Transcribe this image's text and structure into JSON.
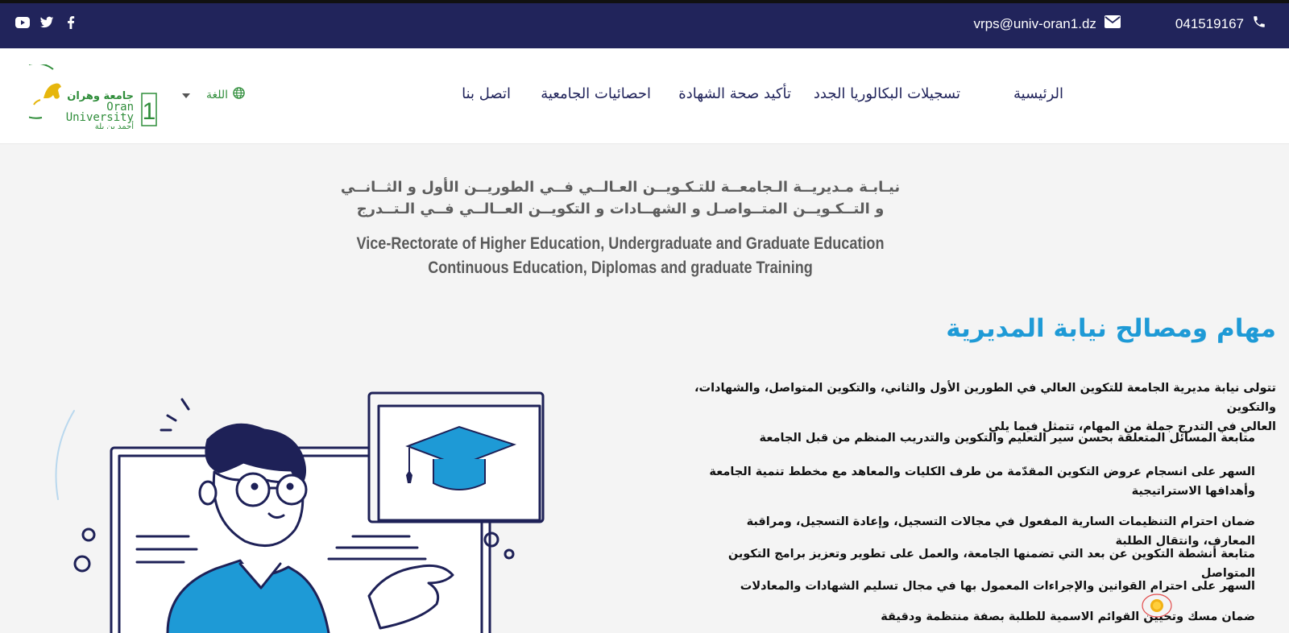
{
  "topbar": {
    "email": "vrps@univ-oran1.dz",
    "phone": "041519167",
    "social_icons": [
      "youtube-icon",
      "twitter-icon",
      "facebook-icon"
    ],
    "colors": {
      "background": "#21245b",
      "text": "#ffffff"
    }
  },
  "header": {
    "logo_text_ar": "جامعة وهران",
    "logo_text_en": "Oran University",
    "logo_number": "1",
    "logo_name_ar": "أحمد بن بلة",
    "language_label": "اللغة",
    "nav": [
      {
        "label": "الرئيسية"
      },
      {
        "label": "تسجيلات البكالوريا الجدد"
      },
      {
        "label": "تأكيد صحة الشهادة"
      },
      {
        "label": "احصائيات الجامعية"
      },
      {
        "label": "اتصل بنا"
      }
    ]
  },
  "hero": {
    "title_ar_line1": "نيـابـة مـديريــة الـجامعــة للتـكـويــن العـالــي فــي الطوريــن الأول و الثــانــي",
    "title_ar_line2": "و التــكـويــن المتــواصـل و الشهــادات و التكويــن العــالــي فــي الـتــدرج",
    "title_en_line1": "Vice-Rectorate of Higher Education, Undergraduate and Graduate Education",
    "title_en_line2": "Continuous Education, Diplomas and graduate Training"
  },
  "content": {
    "section_title": "مهام ومصالح نيابة المديرية",
    "intro_line1": "تتولى نيابة مديرية الجامعة للتكوين العالي في الطورين الأول والثاني، والتكوين المتواصل، والشهادات، والتكوين",
    "intro_line2": "العالي في التدرج جملة من المهام، تتمثل فيما يلي",
    "tasks": [
      "متابعة المسائل المتعلقة بحسن سير التعليم والتكوين والتدريب المنظم من قبل الجامعة",
      "السهر على انسجام عروض التكوين المقدّمة من طرف الكليات والمعاهد مع مخطط تنمية الجامعة وأهدافها الاستراتيجية",
      "ضمان احترام التنظيمات السارية المفعول في مجالات التسجيل، وإعادة التسجيل، ومراقبة المعارف، وانتقال الطلبة",
      "متابعة أنشطة التكوين عن بعد التي تضمنها الجامعة، والعمل على تطوير وتعزيز برامج التكوين المتواصل",
      "السهر على احترام القوانين والإجراءات المعمول بها في مجال تسليم الشهادات والمعادلات",
      "ضمان مسك وتحيين القوائم الاسمية للطلبة بصفة منتظمة ودقيقة"
    ],
    "colors": {
      "section_title": "#1e9ad6",
      "text": "#111111"
    }
  }
}
